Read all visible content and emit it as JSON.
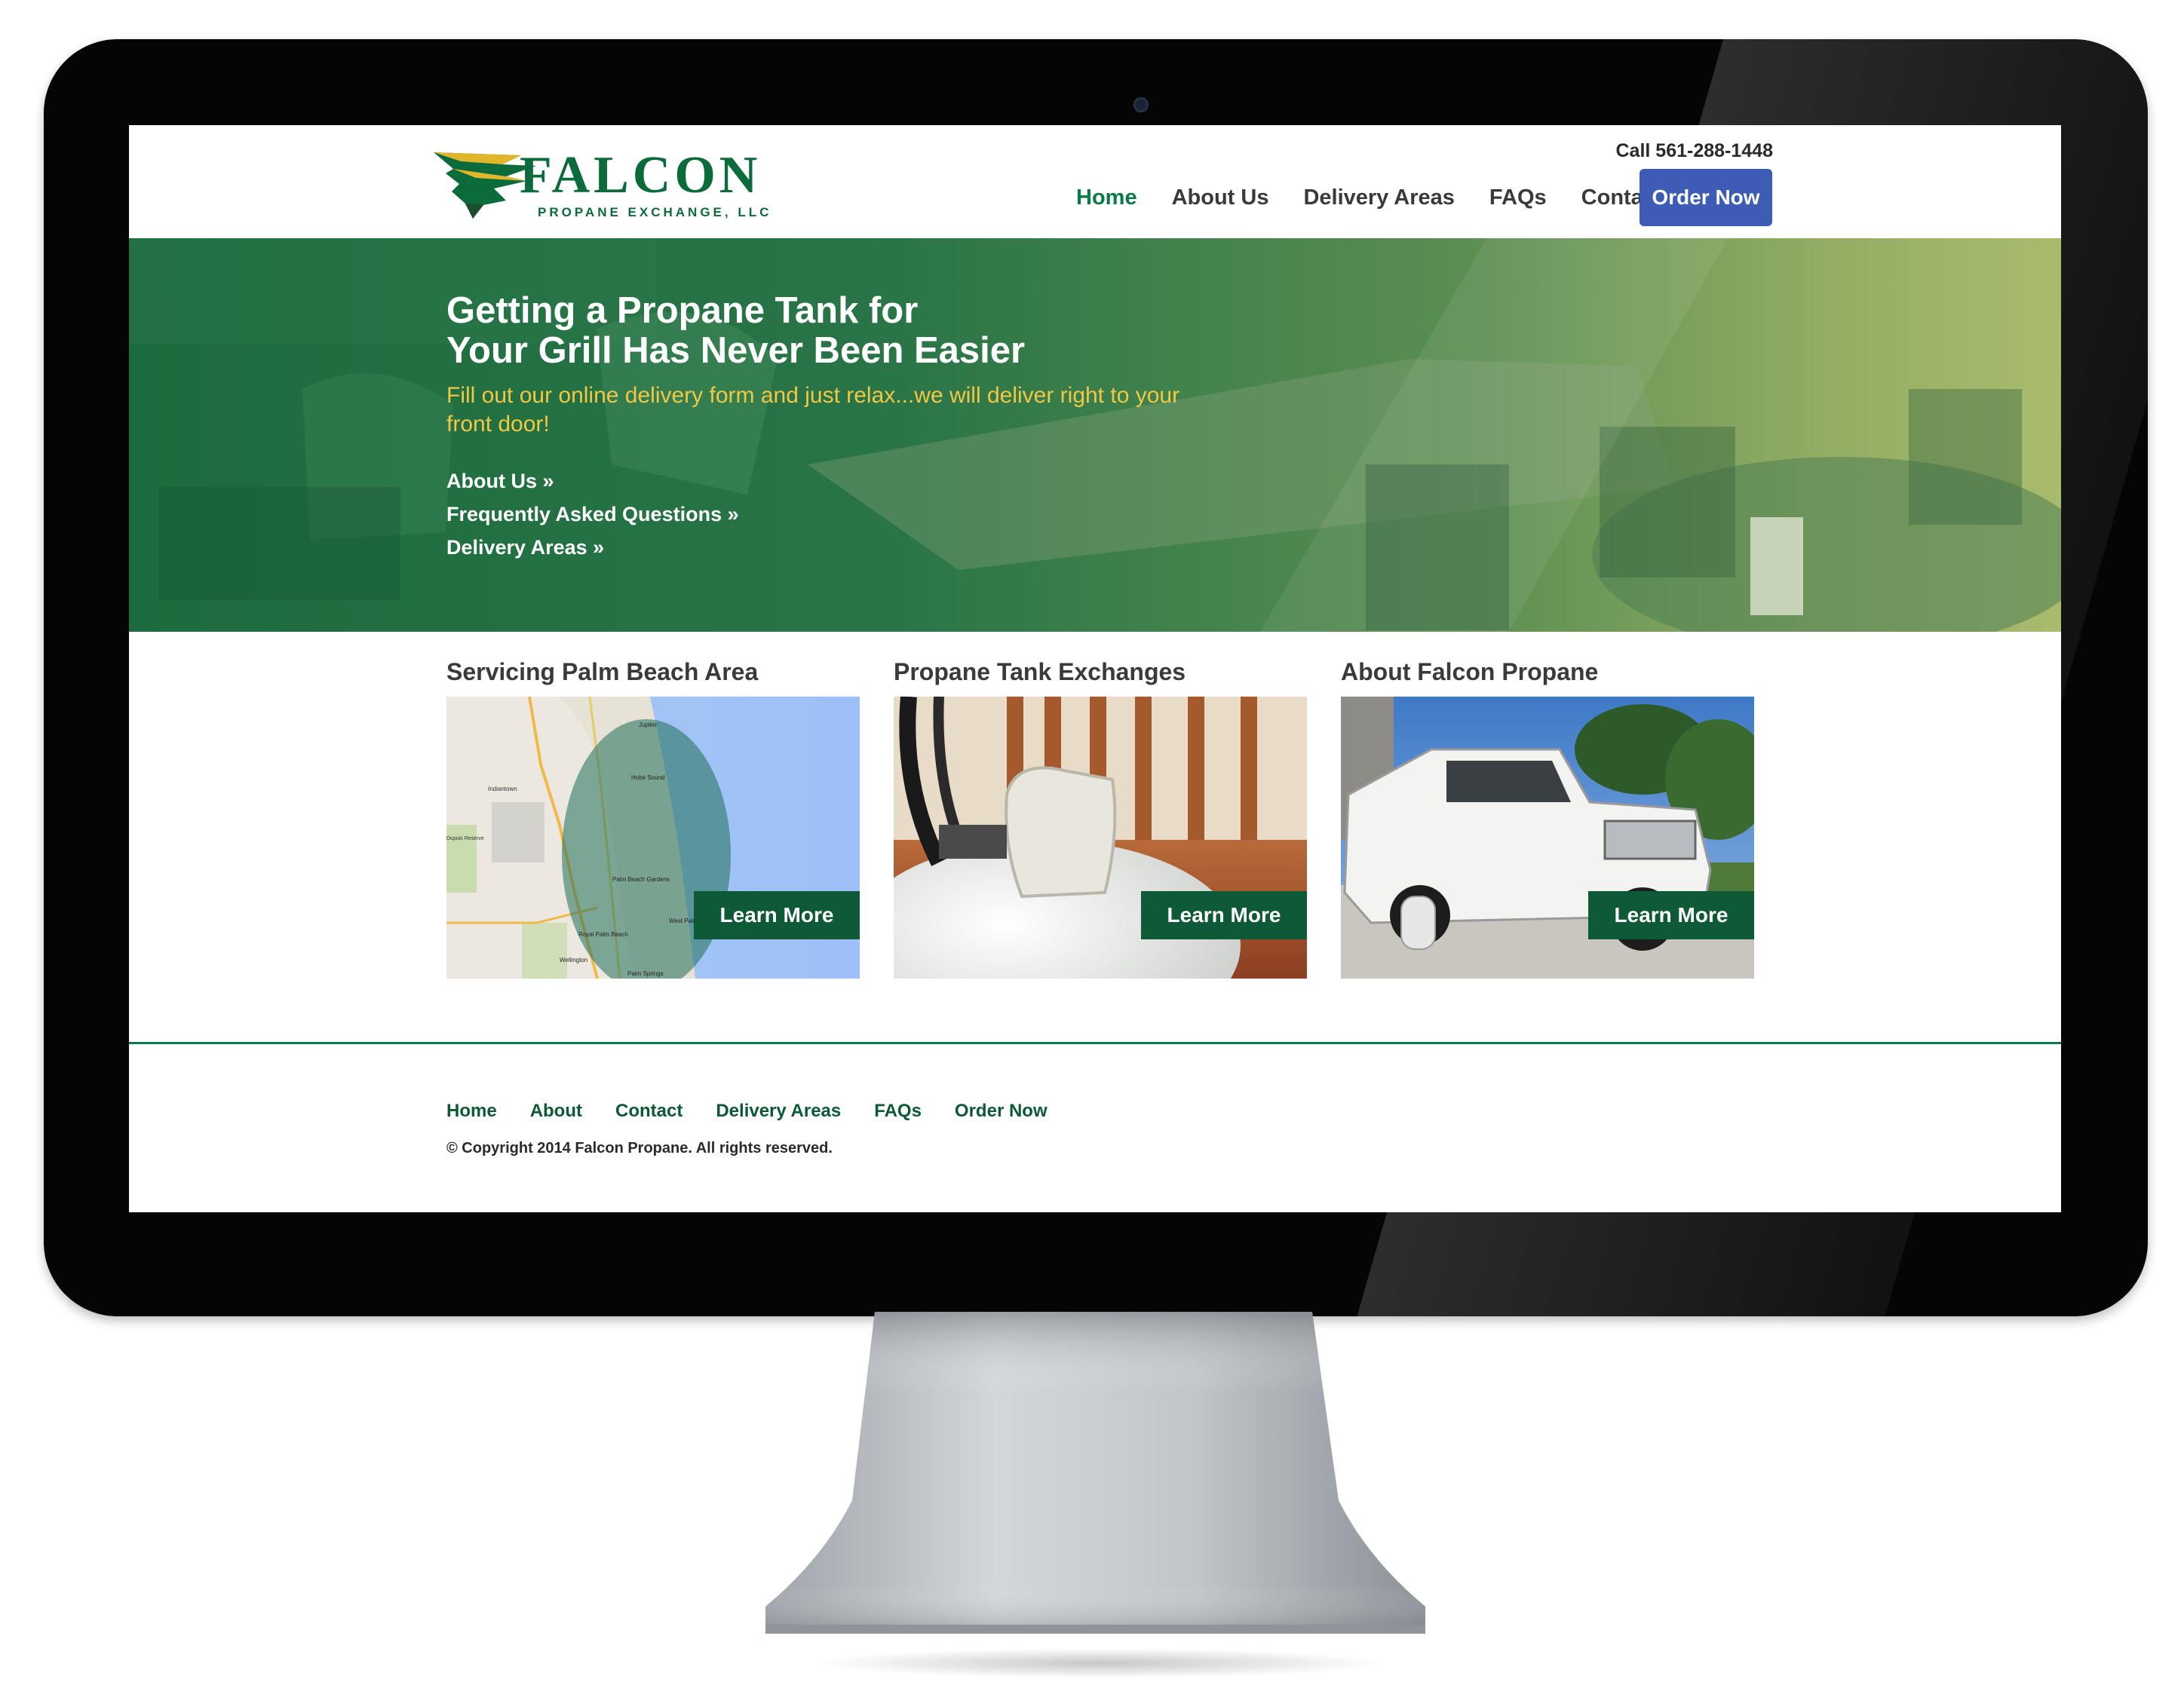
{
  "header": {
    "logo": {
      "name": "FALCON",
      "tagline": "PROPANE EXCHANGE, LLC"
    },
    "phone_prefix": "Call ",
    "phone_number": "561-288-1448",
    "nav": [
      {
        "label": "Home",
        "active": true
      },
      {
        "label": "About Us"
      },
      {
        "label": "Delivery Areas"
      },
      {
        "label": "FAQs"
      },
      {
        "label": "Contact"
      }
    ],
    "order_button": "Order Now"
  },
  "hero": {
    "title_line1": "Getting a Propane Tank for",
    "title_line2": "Your Grill Has Never Been Easier",
    "subtitle": "Fill out our online delivery form and just relax...we will deliver right to your front door!",
    "links": [
      "About Us »",
      "Frequently Asked Questions »",
      "Delivery Areas »"
    ]
  },
  "features": [
    {
      "title": "Servicing Palm Beach Area",
      "button": "Learn More",
      "map_labels": [
        "Indiantown",
        "Dupuis Reserve",
        "Palm Beach Gardens",
        "West Palm Beach",
        "Royal Palm Beach",
        "Wellington",
        "Palm Springs",
        "Jupiter",
        "Hobe Sound"
      ]
    },
    {
      "title": "Propane Tank Exchanges",
      "button": "Learn More"
    },
    {
      "title": "About Falcon Propane",
      "button": "Learn More"
    }
  ],
  "footer": {
    "nav": [
      "Home",
      "About",
      "Contact",
      "Delivery Areas",
      "FAQs",
      "Order Now"
    ],
    "copyright": "© Copyright 2014 Falcon Propane. All rights reserved."
  },
  "colors": {
    "brand_green": "#0b6b3a",
    "nav_active": "#0b7a48",
    "order_button": "#3d5db5",
    "hero_subtitle": "#f2c744",
    "learn_more_bg": "#0f5a36"
  }
}
